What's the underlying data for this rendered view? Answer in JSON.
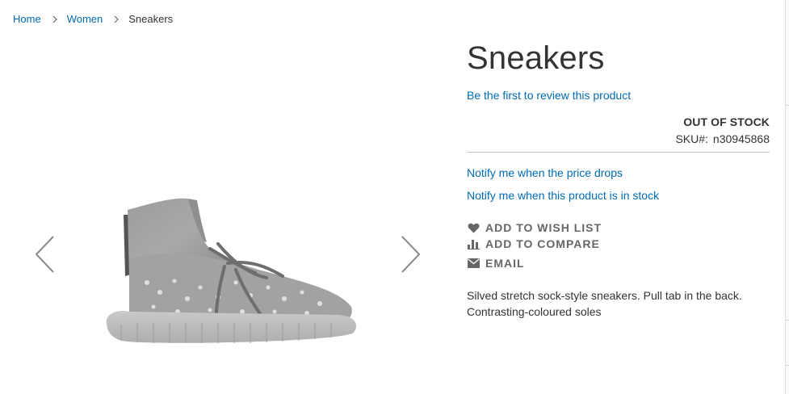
{
  "breadcrumb": {
    "home": "Home",
    "category": "Women",
    "current": "Sneakers"
  },
  "product": {
    "title": "Sneakers",
    "review_link": "Be the first to review this product",
    "stock_status": "OUT OF STOCK",
    "sku_label": "SKU#:",
    "sku_value": "n30945868",
    "price_alert": "Notify me when the price drops",
    "stock_alert": "Notify me when this product is in stock",
    "description": "Silved stretch sock-style sneakers. Pull tab in the back. Contrasting-coloured soles"
  },
  "actions": {
    "wishlist": "ADD TO WISH LIST",
    "compare": "ADD TO COMPARE",
    "email": "EMAIL"
  },
  "icons": {
    "breadcrumb_separator": "chevron-right-icon",
    "gallery_prev": "chevron-left-icon",
    "gallery_next": "chevron-right-icon",
    "wishlist": "heart-icon",
    "compare": "bar-chart-icon",
    "email": "envelope-icon"
  },
  "colors": {
    "link": "#006bb4",
    "text": "#333333",
    "action_text": "#666666",
    "divider": "#c1c1c1"
  }
}
